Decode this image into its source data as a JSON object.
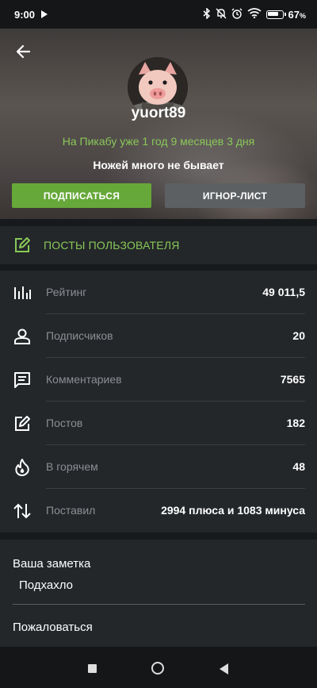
{
  "status_bar": {
    "time": "9:00",
    "battery": "67",
    "battery_unit": "%",
    "icons": [
      "play-icon",
      "bluetooth-icon",
      "mute-icon",
      "alarm-icon",
      "wifi-icon",
      "battery-icon"
    ]
  },
  "header": {
    "username": "yuort89",
    "since": "На Пикабу уже 1 год 9 месяцев 3 дня",
    "motto": "Ножей много не бывает",
    "subscribe_label": "ПОДПИСАТЬСЯ",
    "ignore_label": "ИГНОР-ЛИСТ"
  },
  "posts_link": {
    "label": "ПОСТЫ ПОЛЬЗОВАТЕЛЯ"
  },
  "stats": [
    {
      "icon": "rating-icon",
      "label": "Рейтинг",
      "value": "49 011,5"
    },
    {
      "icon": "subscribers-icon",
      "label": "Подписчиков",
      "value": "20"
    },
    {
      "icon": "comments-icon",
      "label": "Комментариев",
      "value": "7565"
    },
    {
      "icon": "posts-icon",
      "label": "Постов",
      "value": "182"
    },
    {
      "icon": "hot-icon",
      "label": "В горячем",
      "value": "48"
    },
    {
      "icon": "votes-icon",
      "label": "Поставил",
      "value": "2994 плюса и 1083 минуса"
    }
  ],
  "note": {
    "title": "Ваша заметка",
    "text": "Подхахло"
  },
  "complain_label": "Пожаловаться",
  "colors": {
    "accent": "#67a83a",
    "accent_text": "#8ac858",
    "panel": "#23272a",
    "background": "#171a1c"
  }
}
